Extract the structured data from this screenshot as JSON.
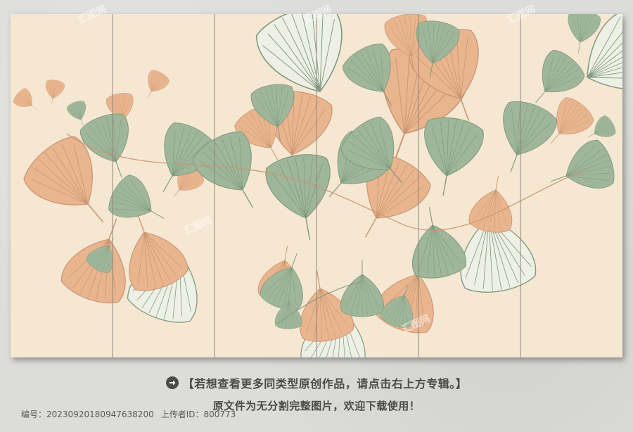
{
  "caption": {
    "line1": "【若想查看更多同类型原创作品，请点击右上方专辑。】",
    "line2": "原文件为无分割完整图片，欢迎下载使用！"
  },
  "meta": {
    "id_label": "编号：",
    "id_value": "20230920180947638200",
    "uploader_label": "上传者ID：",
    "uploader_value": "800773"
  },
  "watermark_text": "汇图网",
  "colors": {
    "background": "#f6e7d2",
    "leaf_green": "#9fb69a",
    "leaf_orange": "#e8b58e",
    "line_green": "#7f9a7c",
    "line_orange": "#c99672",
    "panel_divider": "#8c8680"
  },
  "icons": {
    "arrow": "arrow-right-circle-icon"
  }
}
